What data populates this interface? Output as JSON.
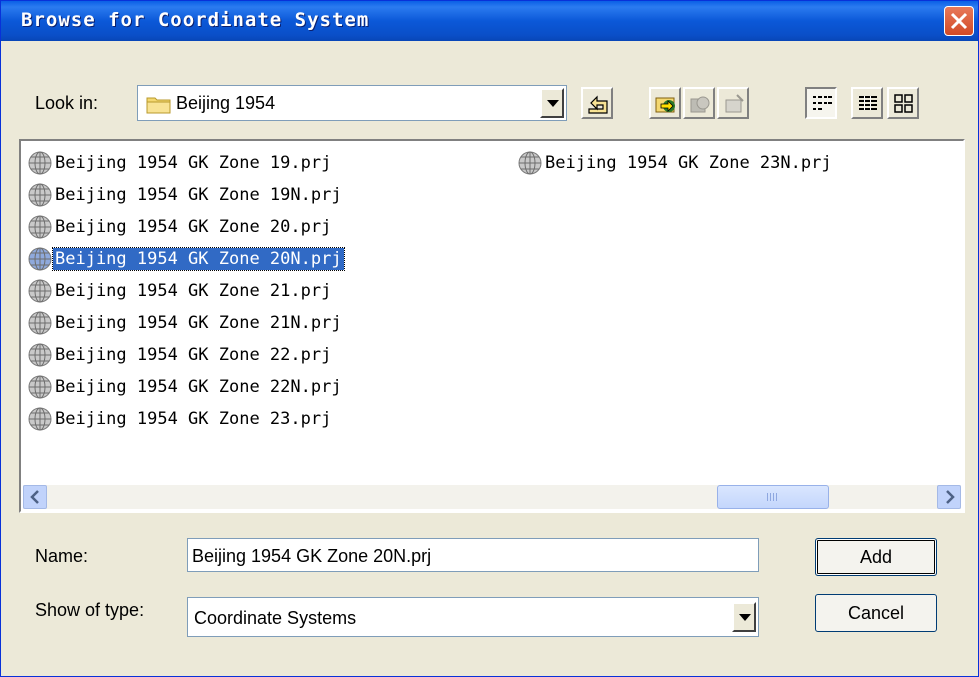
{
  "window": {
    "title": "Browse for Coordinate System"
  },
  "lookin": {
    "label": "Look in:",
    "value": "Beijing 1954"
  },
  "toolbar": {
    "buttons": [
      "up-one-level",
      "add-to-favorites",
      "connect-to-folder",
      "new-item",
      "list-view",
      "details-view",
      "thumbnails-view"
    ]
  },
  "files": [
    {
      "name": "Beijing 1954 GK Zone 19.prj",
      "selected": false
    },
    {
      "name": "Beijing 1954 GK Zone 19N.prj",
      "selected": false
    },
    {
      "name": "Beijing 1954 GK Zone 20.prj",
      "selected": false
    },
    {
      "name": "Beijing 1954 GK Zone 20N.prj",
      "selected": true
    },
    {
      "name": "Beijing 1954 GK Zone 21.prj",
      "selected": false
    },
    {
      "name": "Beijing 1954 GK Zone 21N.prj",
      "selected": false
    },
    {
      "name": "Beijing 1954 GK Zone 22.prj",
      "selected": false
    },
    {
      "name": "Beijing 1954 GK Zone 22N.prj",
      "selected": false
    },
    {
      "name": "Beijing 1954 GK Zone 23.prj",
      "selected": false
    },
    {
      "name": "Beijing 1954 GK Zone 23N.prj",
      "selected": false
    }
  ],
  "name_field": {
    "label": "Name:",
    "value": "Beijing 1954 GK Zone 20N.prj"
  },
  "type_field": {
    "label": "Show of type:",
    "value": "Coordinate Systems"
  },
  "buttons": {
    "add": "Add",
    "cancel": "Cancel"
  },
  "colors": {
    "titlebar": "#0a58d8",
    "selection": "#316ac5",
    "face": "#ece9d8"
  }
}
